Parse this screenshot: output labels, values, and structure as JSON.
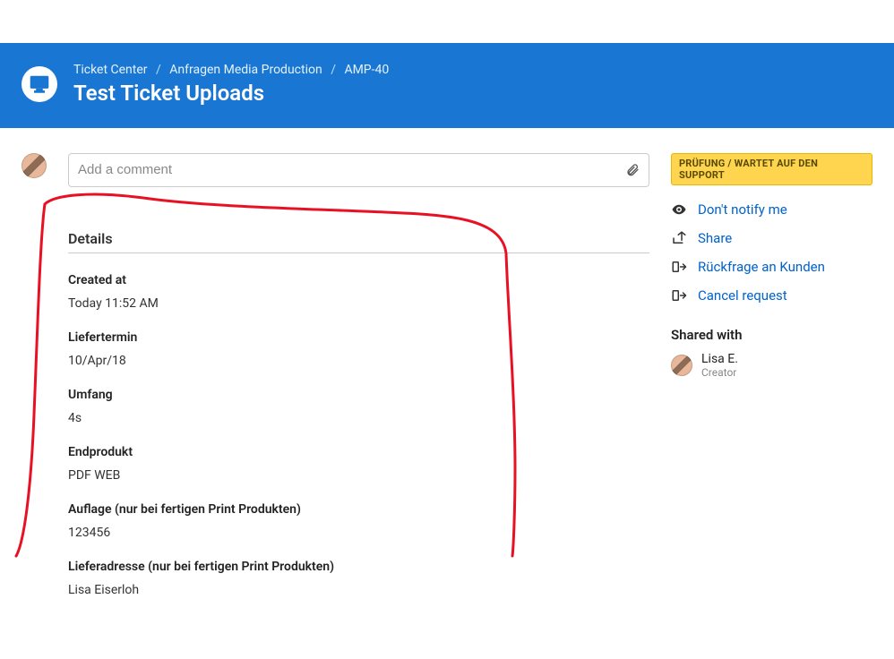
{
  "header": {
    "breadcrumb": [
      "Ticket Center",
      "Anfragen Media Production",
      "AMP-40"
    ],
    "title": "Test Ticket Uploads"
  },
  "comment": {
    "placeholder": "Add a comment"
  },
  "details": {
    "section_title": "Details",
    "fields": [
      {
        "label": "Created at",
        "value": "Today 11:52 AM"
      },
      {
        "label": "Liefertermin",
        "value": "10/Apr/18"
      },
      {
        "label": "Umfang",
        "value": "4s"
      },
      {
        "label": "Endprodukt",
        "value": "PDF WEB"
      },
      {
        "label": "Auflage (nur bei fertigen Print Produkten)",
        "value": "123456"
      },
      {
        "label": "Lieferadresse (nur bei fertigen Print Produkten)",
        "value": "Lisa Eiserloh"
      }
    ]
  },
  "sidebar": {
    "status": "PRÜFUNG / WARTET AUF DEN SUPPORT",
    "actions": [
      {
        "label": "Don't notify me",
        "icon": "eye-icon"
      },
      {
        "label": "Share",
        "icon": "share-icon"
      },
      {
        "label": "Rückfrage an Kunden",
        "icon": "transition-icon"
      },
      {
        "label": "Cancel request",
        "icon": "transition-icon"
      }
    ],
    "shared_title": "Shared with",
    "shared_user": {
      "name": "Lisa E.",
      "role": "Creator"
    }
  }
}
